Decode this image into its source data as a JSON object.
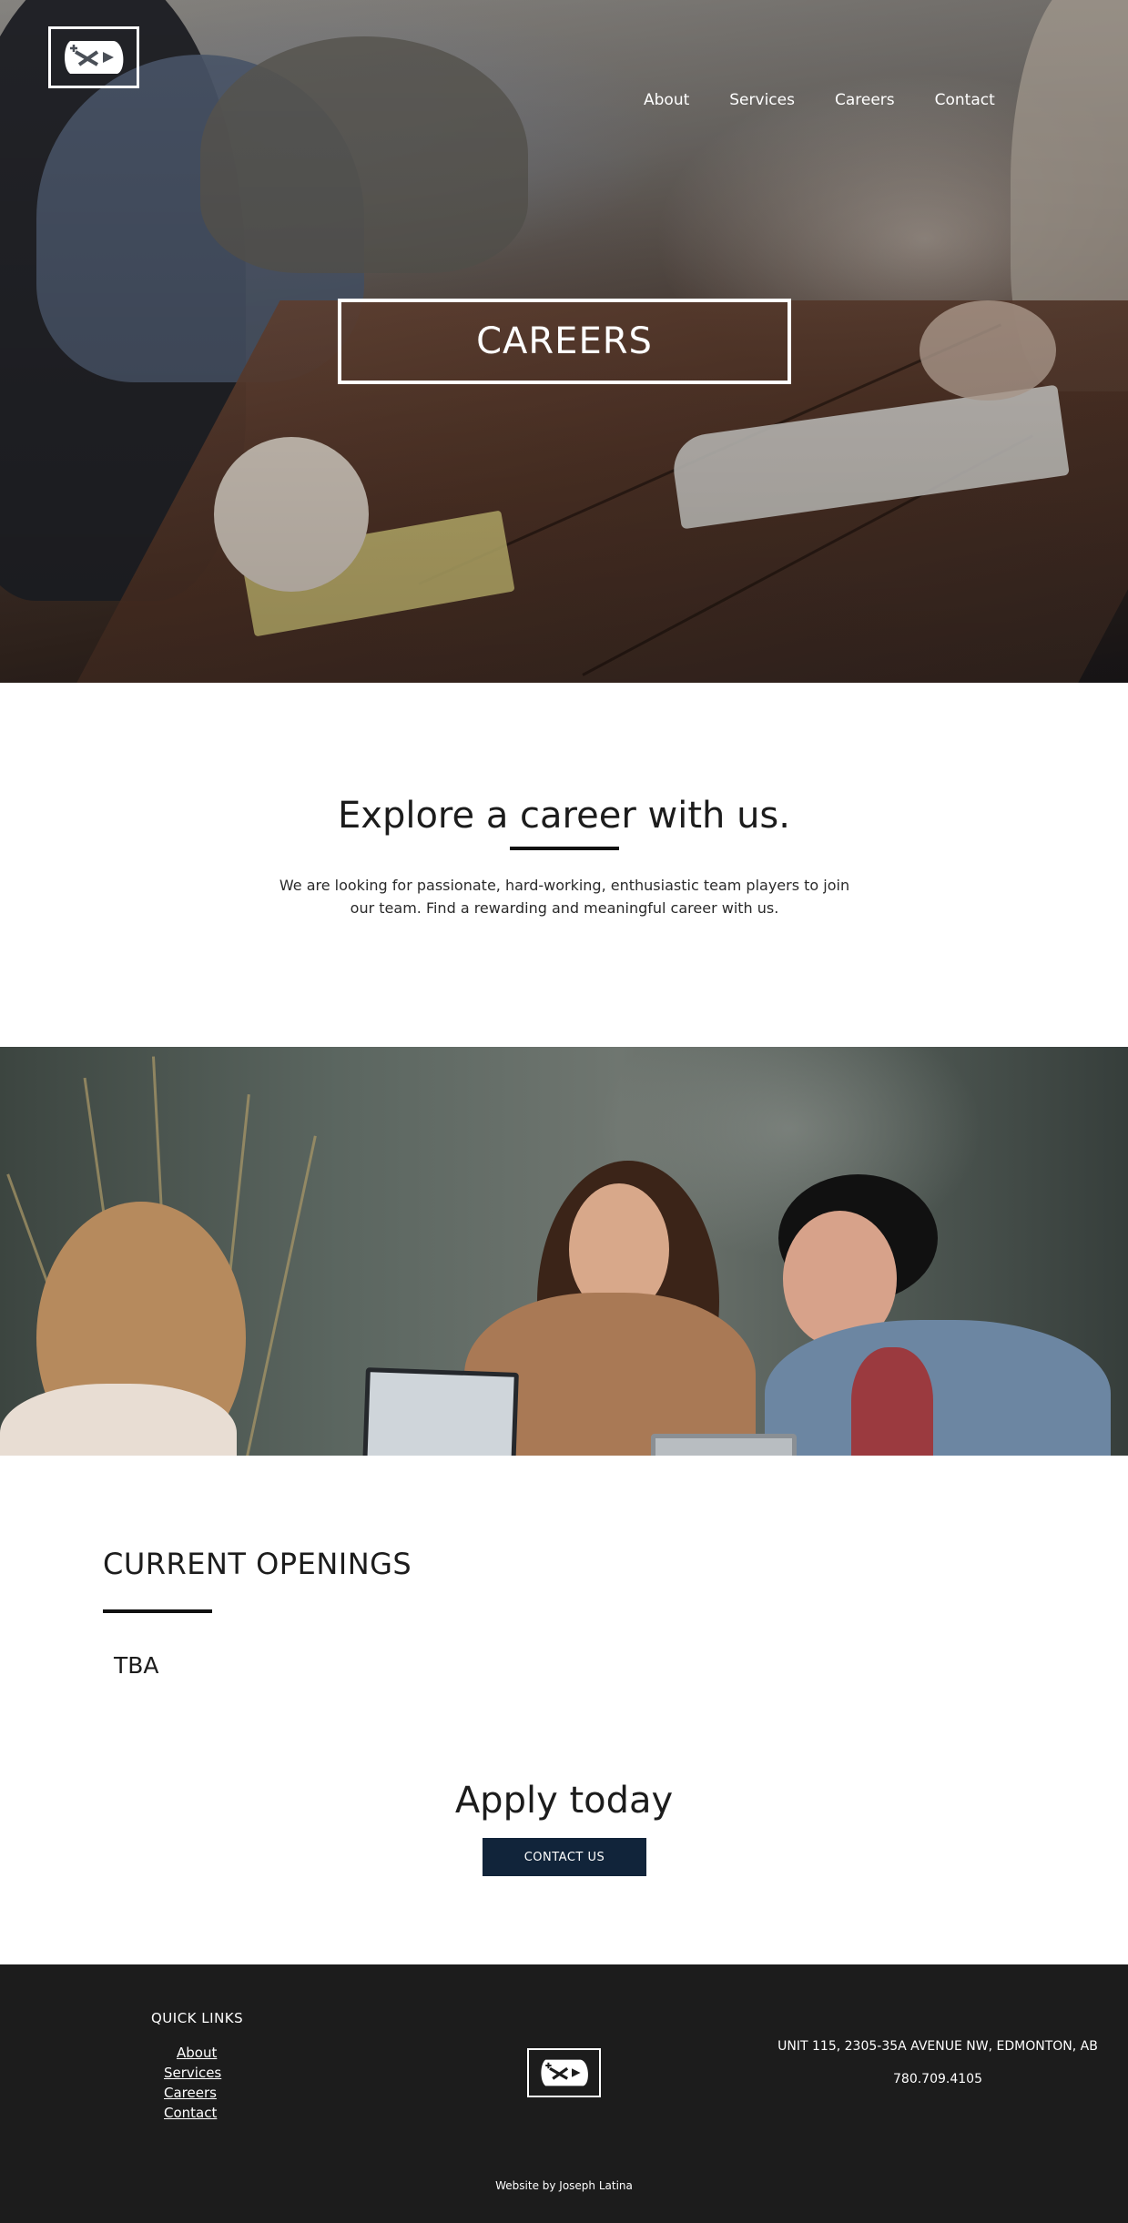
{
  "colors": {
    "button_bg": "#11243a",
    "footer_bg": "#1c1c1c",
    "text": "#1c1c1c",
    "white": "#ffffff"
  },
  "header": {
    "logo_icon": "brand-logo-icon",
    "nav": [
      "About",
      "Services",
      "Careers",
      "Contact"
    ]
  },
  "hero": {
    "title": "CAREERS"
  },
  "explore": {
    "heading": "Explore a career with us.",
    "body": "We are looking for passionate, hard-working, enthusiastic team players to join our team. Find a rewarding and meaningful career with us."
  },
  "openings": {
    "heading": "CURRENT OPENINGS",
    "status": "TBA"
  },
  "apply": {
    "heading": "Apply today",
    "button_label": "CONTACT US"
  },
  "footer": {
    "quick_links_title": "QUICK LINKS",
    "quick_links": [
      "About",
      "Services",
      "Careers",
      "Contact"
    ],
    "logo_icon": "brand-logo-icon",
    "address": "UNIT 115, 2305-35A AVENUE NW, EDMONTON, AB",
    "phone": "780.709.4105",
    "credit": "Website by Joseph Latina"
  }
}
